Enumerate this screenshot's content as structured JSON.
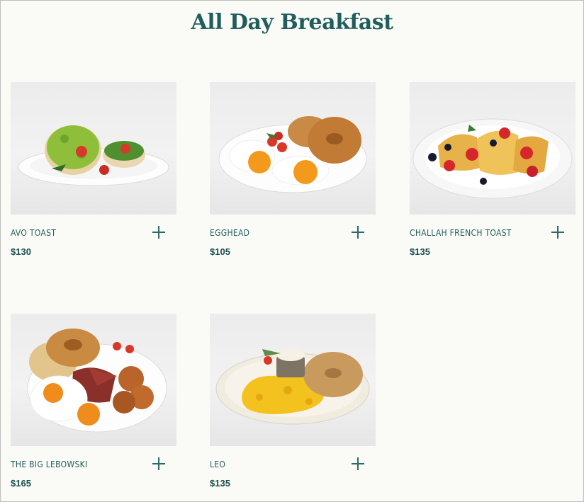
{
  "page": {
    "title": "All Day Breakfast"
  },
  "menu": {
    "items": [
      {
        "name": "AVO TOAST",
        "price": "$130",
        "image": "avocado-toast-photo"
      },
      {
        "name": "EGGHEAD",
        "price": "$105",
        "image": "bagel-eggs-photo"
      },
      {
        "name": "CHALLAH FRENCH TOAST",
        "price": "$135",
        "image": "french-toast-photo"
      },
      {
        "name": "THE BIG LEBOWSKI",
        "price": "$165",
        "image": "big-breakfast-photo"
      },
      {
        "name": "LEO",
        "price": "$135",
        "image": "scrambled-eggs-bagel-photo"
      }
    ],
    "add_icon": "plus-icon"
  },
  "colors": {
    "accent": "#1f5e5b",
    "background": "#fafaf6"
  }
}
